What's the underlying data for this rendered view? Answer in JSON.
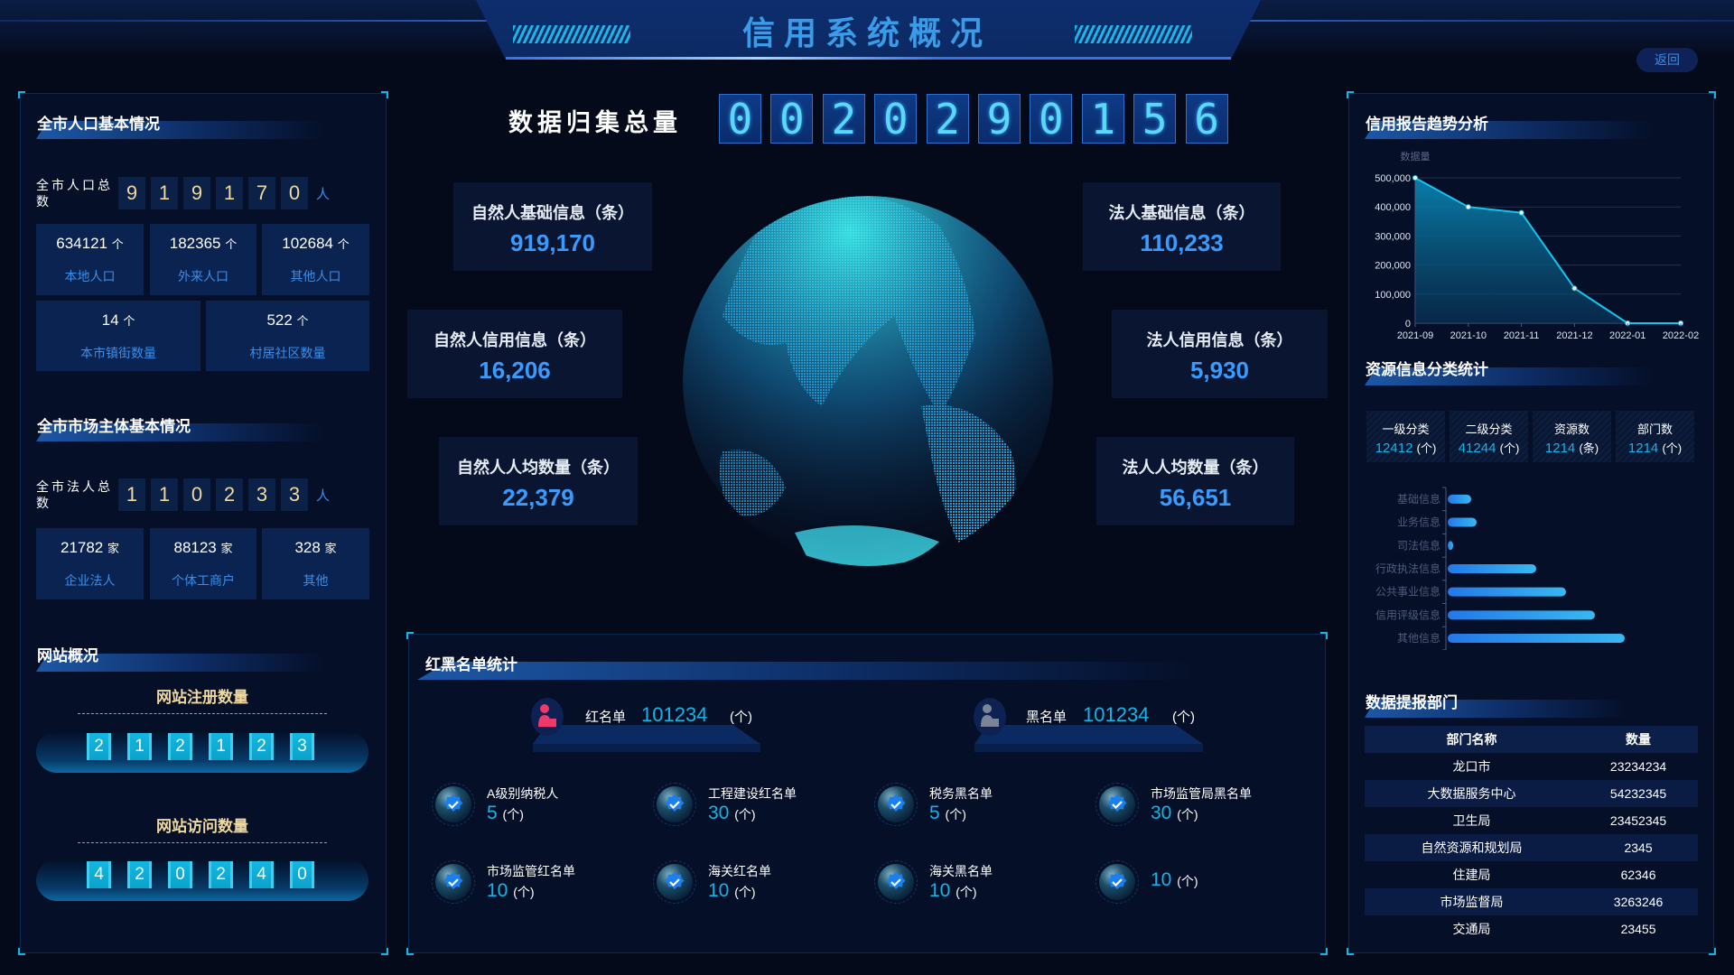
{
  "header": {
    "title": "信用系统概况",
    "back_label": "返回"
  },
  "left": {
    "population": {
      "title": "全市人口基本情况",
      "total_label": "全市人口总数",
      "digits": [
        "9",
        "1",
        "9",
        "1",
        "7",
        "0"
      ],
      "unit": "人",
      "stats": [
        {
          "value": "634121",
          "unit": "个",
          "label": "本地人口"
        },
        {
          "value": "182365",
          "unit": "个",
          "label": "外来人口"
        },
        {
          "value": "102684",
          "unit": "个",
          "label": "其他人口"
        }
      ],
      "stats2": [
        {
          "value": "14",
          "unit": "个",
          "label": "本市镇街数量"
        },
        {
          "value": "522",
          "unit": "个",
          "label": "村居社区数量"
        }
      ]
    },
    "market": {
      "title": "全市市场主体基本情况",
      "total_label": "全市法人总数",
      "digits": [
        "1",
        "1",
        "0",
        "2",
        "3",
        "3"
      ],
      "unit": "人",
      "stats": [
        {
          "value": "21782",
          "unit": "家",
          "label": "企业法人"
        },
        {
          "value": "88123",
          "unit": "家",
          "label": "个体工商户"
        },
        {
          "value": "328",
          "unit": "家",
          "label": "其他"
        }
      ]
    },
    "website": {
      "title": "网站概况",
      "registered_label": "网站注册数量",
      "registered_digits": [
        "2",
        "1",
        "2",
        "1",
        "2",
        "3"
      ],
      "visits_label": "网站访问数量",
      "visits_digits": [
        "4",
        "2",
        "0",
        "2",
        "4",
        "0"
      ]
    }
  },
  "center": {
    "total_label": "数据归集总量",
    "total_digits": [
      "0",
      "0",
      "2",
      "0",
      "2",
      "9",
      "0",
      "1",
      "5",
      "6"
    ],
    "cards": [
      {
        "title": "自然人基础信息（条）",
        "value": "919,170"
      },
      {
        "title": "自然人信用信息（条）",
        "value": "16,206"
      },
      {
        "title": "自然人人均数量（条）",
        "value": "22,379"
      },
      {
        "title": "法人基础信息（条）",
        "value": "110,233"
      },
      {
        "title": "法人信用信息（条）",
        "value": "5,930"
      },
      {
        "title": "法人人均数量（条）",
        "value": "56,651"
      }
    ],
    "redblack": {
      "title": "红黑名单统计",
      "red": {
        "label": "红名单",
        "value": "101234",
        "unit": "(个)",
        "icon": "person-red-icon",
        "color": "#f0386b"
      },
      "black": {
        "label": "黑名单",
        "value": "101234",
        "unit": "(个)",
        "icon": "person-gray-icon",
        "color": "#7c8598"
      },
      "items": [
        {
          "label": "A级别纳税人",
          "value": "5",
          "unit": "(个)"
        },
        {
          "label": "工程建设红名单",
          "value": "30",
          "unit": "(个)"
        },
        {
          "label": "税务黑名单",
          "value": "5",
          "unit": "(个)"
        },
        {
          "label": "市场监管局黑名单",
          "value": "30",
          "unit": "(个)"
        },
        {
          "label": "市场监管红名单",
          "value": "10",
          "unit": "(个)"
        },
        {
          "label": "海关红名单",
          "value": "10",
          "unit": "(个)"
        },
        {
          "label": "海关黑名单",
          "value": "10",
          "unit": "(个)"
        },
        {
          "label": "",
          "value": "10",
          "unit": "(个)"
        }
      ]
    }
  },
  "right": {
    "trend_title": "信用报告趋势分析",
    "resource_title": "资源信息分类统计",
    "resource_stats": [
      {
        "label": "一级分类",
        "value": "12412",
        "unit": "(个)"
      },
      {
        "label": "二级分类",
        "value": "41244",
        "unit": "(个)"
      },
      {
        "label": "资源数",
        "value": "1214",
        "unit": "(条)"
      },
      {
        "label": "部门数",
        "value": "1214",
        "unit": "(个)"
      }
    ],
    "dept_title": "数据提报部门",
    "dept_table": {
      "headers": [
        "部门名称",
        "数量"
      ],
      "rows": [
        [
          "龙口市",
          "23234234"
        ],
        [
          "大数据服务中心",
          "54232345"
        ],
        [
          "卫生局",
          "23452345"
        ],
        [
          "自然资源和规划局",
          "2345"
        ],
        [
          "住建局",
          "62346"
        ],
        [
          "市场监督局",
          "3263246"
        ],
        [
          "交通局",
          "23455"
        ]
      ]
    }
  },
  "chart_data": [
    {
      "type": "area",
      "title": "",
      "ylabel": "数据量",
      "categories": [
        "2021-09",
        "2021-10",
        "2021-11",
        "2021-12",
        "2022-01",
        "2022-02"
      ],
      "values": [
        500000,
        400000,
        380000,
        120000,
        0,
        0
      ],
      "ylim": [
        0,
        500000
      ],
      "yticks": [
        "0",
        "100,000",
        "200,000",
        "300,000",
        "400,000",
        "500,000"
      ],
      "grid": true,
      "color": "#12c6f0"
    },
    {
      "type": "bar",
      "orientation": "horizontal",
      "categories": [
        "基础信息",
        "业务信息",
        "司法信息",
        "行政执法信息",
        "公共事业信息",
        "信用评级信息",
        "其他信息"
      ],
      "values": [
        26,
        32,
        6,
        98,
        131,
        163,
        196
      ],
      "color": "#2a8ef0"
    }
  ]
}
